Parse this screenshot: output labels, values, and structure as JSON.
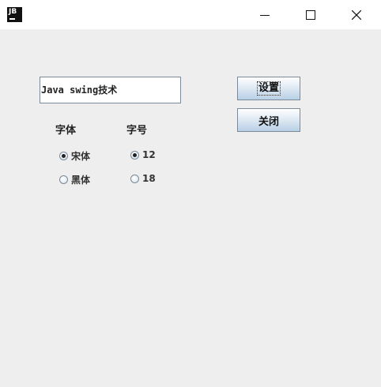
{
  "titlebar": {
    "app_icon_text": "JB"
  },
  "text_field": {
    "value": "Java swing技术"
  },
  "buttons": {
    "set_label": "设置",
    "close_label": "关闭"
  },
  "font_group": {
    "label": "字体",
    "options": [
      {
        "label": "宋体",
        "selected": true
      },
      {
        "label": "黑体",
        "selected": false
      }
    ]
  },
  "size_group": {
    "label": "字号",
    "options": [
      {
        "label": "12",
        "selected": true
      },
      {
        "label": "18",
        "selected": false
      }
    ]
  }
}
